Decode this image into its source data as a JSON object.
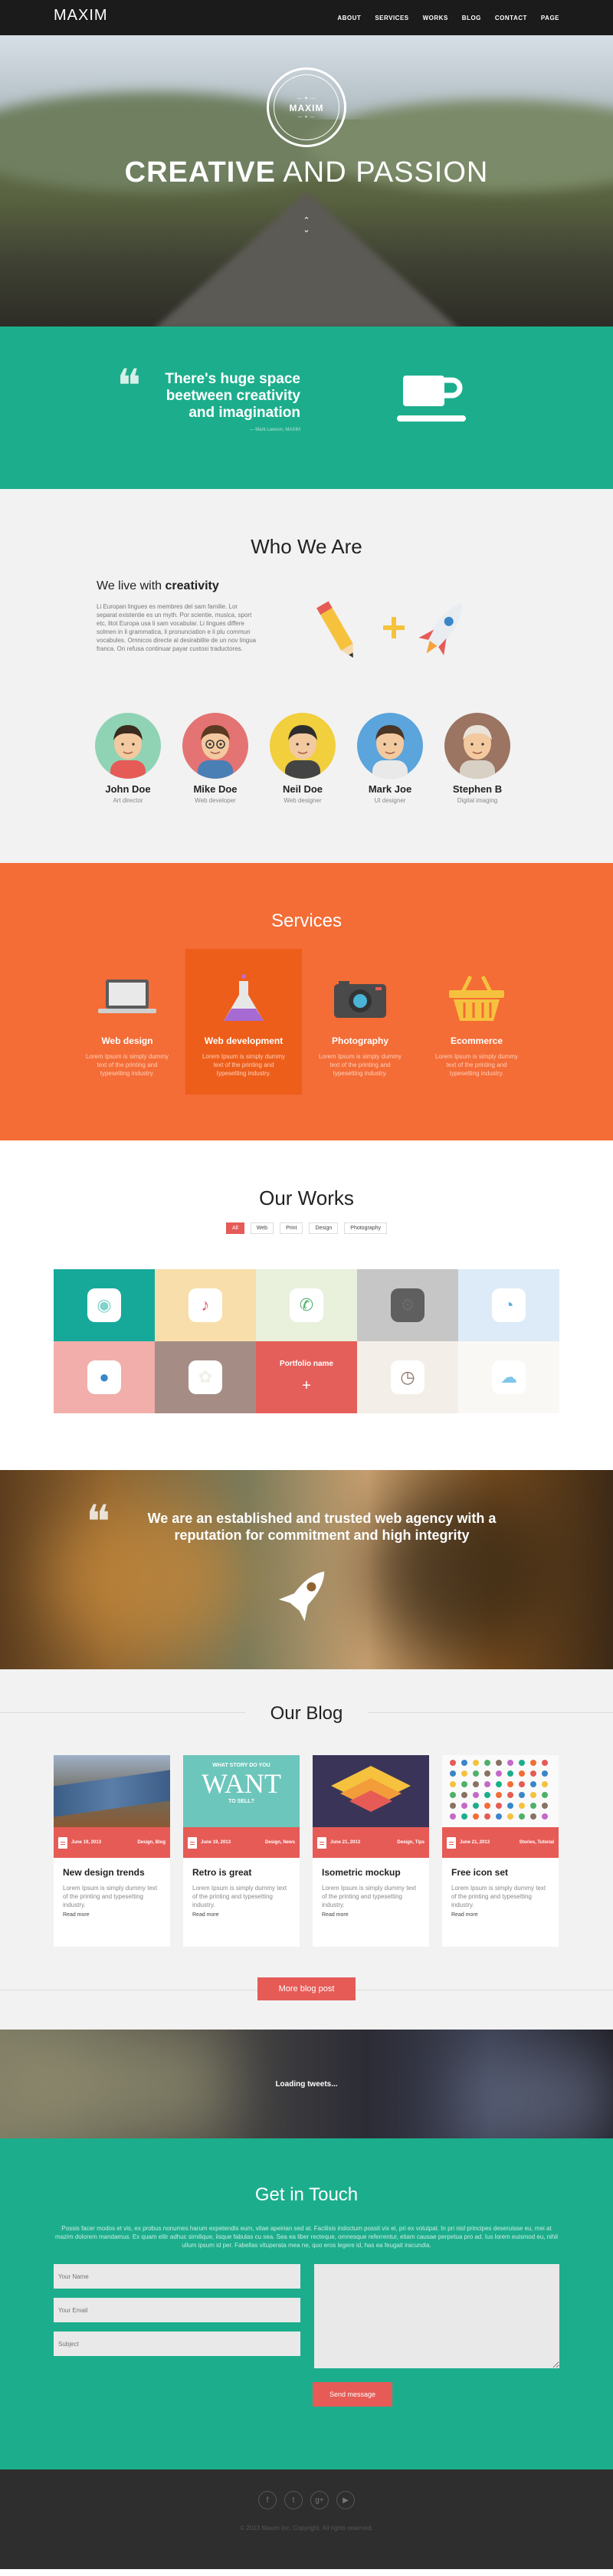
{
  "nav": {
    "logo": "MAXIM",
    "items": [
      "ABOUT",
      "SERVICES",
      "WORKS",
      "BLOG",
      "CONTACT",
      "PAGE"
    ]
  },
  "hero": {
    "badge_top": "— ✦ —",
    "badge_name": "MAXIM",
    "badge_sub": "— ✦ —",
    "headline_bold": "CREATIVE",
    "headline_rest": " AND PASSION"
  },
  "quote1": {
    "text": "There's huge space beetween creativity and imagination",
    "author": "— Mark Lawson, MAXIM"
  },
  "who": {
    "title": "Who We Are",
    "subtitle_pre": "We live with ",
    "subtitle_bold": "creativity",
    "intro": "Li Europan lingues es membres del sam familie. Lor separat existentie es un myth. Por scientie, musica, sport etc, litot Europa usa li sam vocabular. Li lingues differe solmen in li grammatica, li pronunciation e li plu commun vocabules. Omnicos directe al desirabilite de un nov lingua franca. On refusa continuar payar custosi traductores.",
    "team": [
      {
        "name": "John Doe",
        "role": "Art director",
        "bg": "#8fd3b4"
      },
      {
        "name": "Mike Doe",
        "role": "Web developer",
        "bg": "#e47373"
      },
      {
        "name": "Neil Doe",
        "role": "Web designer",
        "bg": "#f1cf3d"
      },
      {
        "name": "Mark Joe",
        "role": "UI designer",
        "bg": "#5ba4dc"
      },
      {
        "name": "Stephen B",
        "role": "Digital imaging",
        "bg": "#9b7462"
      }
    ]
  },
  "services": {
    "title": "Services",
    "items": [
      {
        "title": "Web design",
        "desc": "Lorem Ipsum is simply dummy text of the printing and typesetting industry."
      },
      {
        "title": "Web development",
        "desc": "Lorem Ipsum is simply dummy text of the printing and typesetting industry."
      },
      {
        "title": "Photography",
        "desc": "Lorem Ipsum is simply dummy text of the printing and typesetting industry."
      },
      {
        "title": "Ecommerce",
        "desc": "Lorem Ipsum is simply dummy text of the printing and typesetting industry."
      }
    ]
  },
  "works": {
    "title": "Our Works",
    "filters": [
      "All",
      "Web",
      "Print",
      "Design",
      "Photography"
    ],
    "overlay_title": "Portfolio name",
    "overlay_plus": "+",
    "tiles": [
      {
        "bg": "#16a99a",
        "icon": "camera-app-icon",
        "glyph": "◉",
        "color": "#7fd3c9"
      },
      {
        "bg": "#f8deab",
        "icon": "music-app-icon",
        "glyph": "♪",
        "color": "#e4606a"
      },
      {
        "bg": "#e9f1dd",
        "icon": "phone-app-icon",
        "glyph": "✆",
        "color": "#4fb06a"
      },
      {
        "bg": "#c6c6c6",
        "icon": "settings-app-icon",
        "glyph": "⚙",
        "color": "#6b6b6b"
      },
      {
        "bg": "#dcebf7",
        "icon": "safari-app-icon",
        "glyph": "◔",
        "color": "#56aee4"
      },
      {
        "bg": "#f2aeaa",
        "icon": "chat-app-icon",
        "glyph": "●",
        "color": "#3a86c8"
      },
      {
        "bg": "#a58d85",
        "icon": "photos-app-icon",
        "glyph": "✿",
        "color": "#f2efe8"
      },
      {
        "bg": "#e55f5a",
        "icon": "portfolio-overlay",
        "glyph": "",
        "color": "#fff"
      },
      {
        "bg": "#f3efe8",
        "icon": "clock-app-icon",
        "glyph": "◷",
        "color": "#8a7262"
      },
      {
        "bg": "#faf8f5",
        "icon": "weather-app-icon",
        "glyph": "☁",
        "color": "#7fc6ea"
      }
    ]
  },
  "quote2": {
    "text": "We are an established and trusted web agency with a reputation for commitment and high integrity"
  },
  "blog": {
    "title": "Our Blog",
    "posts": [
      {
        "date": "June 19, 2013",
        "tags": "Design, Blog",
        "title": "New design trends",
        "excerpt": "Lorem Ipsum is simply dummy text of the printing and typesetting industry.",
        "more": "Read more"
      },
      {
        "date": "June 19, 2013",
        "tags": "Design, News",
        "title": "Retro is great",
        "excerpt": "Lorem Ipsum is simply dummy text of the printing and typesetting industry.",
        "more": "Read more"
      },
      {
        "date": "June 21, 2013",
        "tags": "Design, Tips",
        "title": "Isometric mockup",
        "excerpt": "Lorem Ipsum is simply dummy text of the printing and typesetting industry.",
        "more": "Read more"
      },
      {
        "date": "June 21, 2013",
        "tags": "Stories, Tutorial",
        "title": "Free icon set",
        "excerpt": "Lorem Ipsum is simply dummy text of the printing and typesetting industry.",
        "more": "Read more"
      }
    ],
    "retro_small": "WHAT STORY DO YOU",
    "retro_big": "WANT",
    "retro_small2": "TO SELL?",
    "more_button": "More blog post"
  },
  "tweets": {
    "loading": "Loading tweets..."
  },
  "contact": {
    "title": "Get in Touch",
    "text": "Possis facer modos et vis, ex probus nonumes harum expetendis eum, vitae apeirian sed at. Facilisis indoctum possit vix ei, pri ex volutpat. In pri nisl principes deseruisse eu, mei at mazim dolorem mandamus. Ex quam elitr adhuc similique, iisque fabulas cu sea. Sea ea liber recteque, omnesque referrentur, etiam causae perpetua pro ad. Ius lorem euismod eu, nihil ullum ipsum id per. Fabellas vituperata mea ne, quo eros legere id, has ea feugait iracundia.",
    "name_placeholder": "Your Name",
    "email_placeholder": "Your Email",
    "subject_placeholder": "Subject",
    "message_placeholder": "",
    "send": "Send message"
  },
  "footer": {
    "social": [
      "f",
      "t",
      "g+",
      "▶"
    ],
    "copyright": "© 2013 Maxim Inc. Copyright. All rights reserved."
  },
  "colors": {
    "teal": "#1cae8c",
    "orange": "#f46c36",
    "coral": "#e65b56",
    "dark": "#1b1b1b"
  }
}
